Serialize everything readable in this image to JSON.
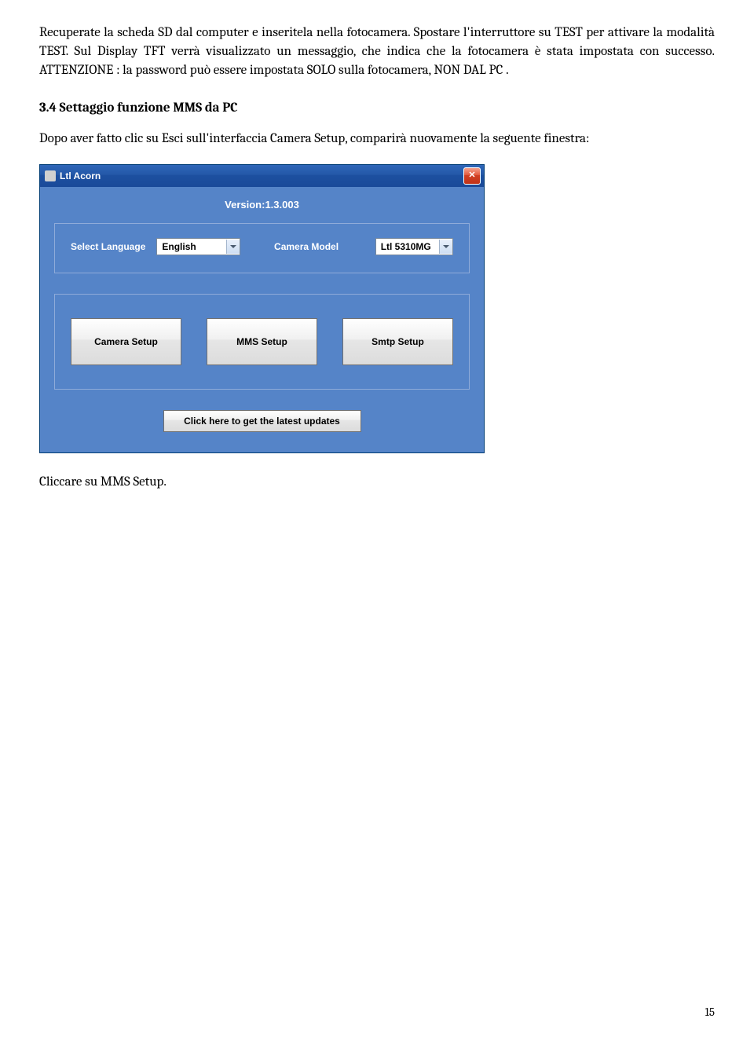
{
  "doc": {
    "p1": "Recuperate la scheda SD dal computer e inseritela nella fotocamera. Spostare l'interruttore su TEST per attivare la modalità TEST. Sul Display TFT verrà visualizzato un messaggio, che indica che la fotocamera è stata impostata con successo. ATTENZIONE : la password può essere impostata SOLO sulla fotocamera, NON DAL PC .",
    "section_title": "3.4 Settaggio funzione MMS da PC",
    "p2": "Dopo aver fatto clic su Esci sull'interfaccia Camera Setup, comparirà nuovamente la seguente finestra:",
    "after_img": "Cliccare su MMS Setup.",
    "page_number": "15"
  },
  "app": {
    "title": "Ltl Acorn",
    "version": "Version:1.3.003",
    "select_language_label": "Select Language",
    "select_language_value": "English",
    "camera_model_label": "Camera Model",
    "camera_model_value": "Ltl 5310MG",
    "btn_camera_setup": "Camera Setup",
    "btn_mms_setup": "MMS Setup",
    "btn_smtp_setup": "Smtp Setup",
    "btn_update": "Click here to get the latest updates"
  }
}
